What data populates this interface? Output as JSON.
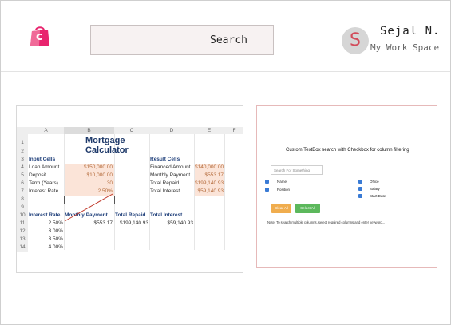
{
  "header": {
    "logo_letter": "c",
    "search_label": "Search",
    "avatar_letter": "S",
    "user_name": "Sejal N.",
    "workspace": "My Work Space",
    "colors": {
      "logo_bag": "#e8246e",
      "avatar_letter": "#d24b5a"
    }
  },
  "spreadsheet": {
    "columns": [
      "A",
      "B",
      "C",
      "D",
      "E",
      "F"
    ],
    "rows": [
      "1",
      "2",
      "3",
      "4",
      "5",
      "6",
      "7",
      "8",
      "9",
      "10",
      "11",
      "12",
      "13",
      "14"
    ],
    "title": "Mortgage Calculator",
    "input_header": "Input Cells",
    "inputs": [
      {
        "label": "Loan Amount",
        "value": "$150,000.00"
      },
      {
        "label": "Deposit",
        "value": "$10,000.00"
      },
      {
        "label": "Term (Years)",
        "value": "30"
      },
      {
        "label": "Interest Rate",
        "value": "2.50%"
      }
    ],
    "result_header": "Result Cells",
    "results": [
      {
        "label": "Financed Amount",
        "value": "$140,000.00"
      },
      {
        "label": "Monthly Payment",
        "value": "$553.17"
      },
      {
        "label": "Total Repaid",
        "value": "$199,140.93"
      },
      {
        "label": "Total Interest",
        "value": "$59,140.93"
      }
    ],
    "table_headers": [
      "Interest Rate",
      "Monthly Payment",
      "Total Repaid",
      "Total Interest"
    ],
    "table_first_row": [
      "2.50%",
      "$553.17",
      "$199,140.93",
      "$59,140.93"
    ],
    "rates": [
      "3.00%",
      "3.50%",
      "4.00%"
    ]
  },
  "filter_demo": {
    "title": "Custom TextBox search with Checkbox for column filtering",
    "placeholder": "Search For Something",
    "checkboxes_left": [
      "Name",
      "Position"
    ],
    "checkboxes_right": [
      "Office",
      "Salary",
      "Start Date"
    ],
    "clear_label": "Clear All",
    "select_label": "Select All",
    "note": "Note: To search multiple columns, select required columns and enter keyword...",
    "colors": {
      "clear": "#f0ad4e",
      "select": "#5cb85c",
      "check": "#3a7bd5"
    }
  }
}
